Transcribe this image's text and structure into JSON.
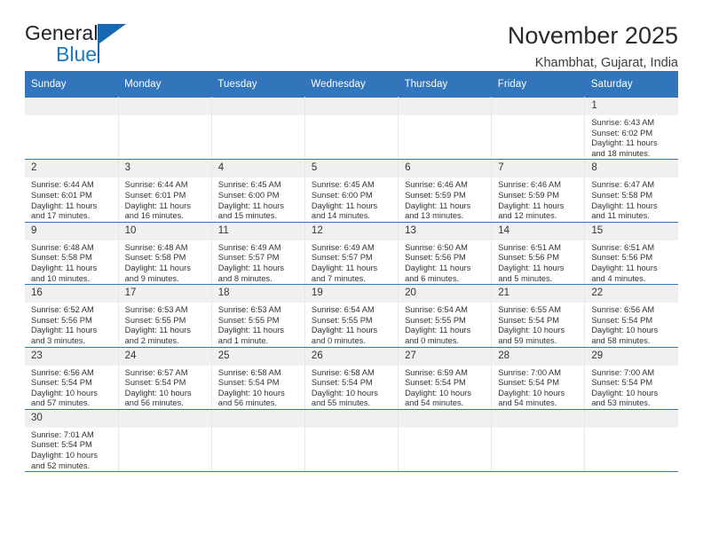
{
  "brand": {
    "name_part1": "General",
    "name_part2": "Blue"
  },
  "header": {
    "title": "November 2025",
    "subtitle": "Khambhat, Gujarat, India"
  },
  "colors": {
    "header_blue": "#3275bb",
    "logo_blue": "#1b7ac2",
    "daynum_band": "#f0f0f0"
  },
  "calendar": {
    "weekday_headers": [
      "Sunday",
      "Monday",
      "Tuesday",
      "Wednesday",
      "Thursday",
      "Friday",
      "Saturday"
    ],
    "weeks": [
      [
        {
          "day": "",
          "lines": []
        },
        {
          "day": "",
          "lines": []
        },
        {
          "day": "",
          "lines": []
        },
        {
          "day": "",
          "lines": []
        },
        {
          "day": "",
          "lines": []
        },
        {
          "day": "",
          "lines": []
        },
        {
          "day": "1",
          "lines": [
            "Sunrise: 6:43 AM",
            "Sunset: 6:02 PM",
            "Daylight: 11 hours",
            "and 18 minutes."
          ]
        }
      ],
      [
        {
          "day": "2",
          "lines": [
            "Sunrise: 6:44 AM",
            "Sunset: 6:01 PM",
            "Daylight: 11 hours",
            "and 17 minutes."
          ]
        },
        {
          "day": "3",
          "lines": [
            "Sunrise: 6:44 AM",
            "Sunset: 6:01 PM",
            "Daylight: 11 hours",
            "and 16 minutes."
          ]
        },
        {
          "day": "4",
          "lines": [
            "Sunrise: 6:45 AM",
            "Sunset: 6:00 PM",
            "Daylight: 11 hours",
            "and 15 minutes."
          ]
        },
        {
          "day": "5",
          "lines": [
            "Sunrise: 6:45 AM",
            "Sunset: 6:00 PM",
            "Daylight: 11 hours",
            "and 14 minutes."
          ]
        },
        {
          "day": "6",
          "lines": [
            "Sunrise: 6:46 AM",
            "Sunset: 5:59 PM",
            "Daylight: 11 hours",
            "and 13 minutes."
          ]
        },
        {
          "day": "7",
          "lines": [
            "Sunrise: 6:46 AM",
            "Sunset: 5:59 PM",
            "Daylight: 11 hours",
            "and 12 minutes."
          ]
        },
        {
          "day": "8",
          "lines": [
            "Sunrise: 6:47 AM",
            "Sunset: 5:58 PM",
            "Daylight: 11 hours",
            "and 11 minutes."
          ]
        }
      ],
      [
        {
          "day": "9",
          "lines": [
            "Sunrise: 6:48 AM",
            "Sunset: 5:58 PM",
            "Daylight: 11 hours",
            "and 10 minutes."
          ]
        },
        {
          "day": "10",
          "lines": [
            "Sunrise: 6:48 AM",
            "Sunset: 5:58 PM",
            "Daylight: 11 hours",
            "and 9 minutes."
          ]
        },
        {
          "day": "11",
          "lines": [
            "Sunrise: 6:49 AM",
            "Sunset: 5:57 PM",
            "Daylight: 11 hours",
            "and 8 minutes."
          ]
        },
        {
          "day": "12",
          "lines": [
            "Sunrise: 6:49 AM",
            "Sunset: 5:57 PM",
            "Daylight: 11 hours",
            "and 7 minutes."
          ]
        },
        {
          "day": "13",
          "lines": [
            "Sunrise: 6:50 AM",
            "Sunset: 5:56 PM",
            "Daylight: 11 hours",
            "and 6 minutes."
          ]
        },
        {
          "day": "14",
          "lines": [
            "Sunrise: 6:51 AM",
            "Sunset: 5:56 PM",
            "Daylight: 11 hours",
            "and 5 minutes."
          ]
        },
        {
          "day": "15",
          "lines": [
            "Sunrise: 6:51 AM",
            "Sunset: 5:56 PM",
            "Daylight: 11 hours",
            "and 4 minutes."
          ]
        }
      ],
      [
        {
          "day": "16",
          "lines": [
            "Sunrise: 6:52 AM",
            "Sunset: 5:56 PM",
            "Daylight: 11 hours",
            "and 3 minutes."
          ]
        },
        {
          "day": "17",
          "lines": [
            "Sunrise: 6:53 AM",
            "Sunset: 5:55 PM",
            "Daylight: 11 hours",
            "and 2 minutes."
          ]
        },
        {
          "day": "18",
          "lines": [
            "Sunrise: 6:53 AM",
            "Sunset: 5:55 PM",
            "Daylight: 11 hours",
            "and 1 minute."
          ]
        },
        {
          "day": "19",
          "lines": [
            "Sunrise: 6:54 AM",
            "Sunset: 5:55 PM",
            "Daylight: 11 hours",
            "and 0 minutes."
          ]
        },
        {
          "day": "20",
          "lines": [
            "Sunrise: 6:54 AM",
            "Sunset: 5:55 PM",
            "Daylight: 11 hours",
            "and 0 minutes."
          ]
        },
        {
          "day": "21",
          "lines": [
            "Sunrise: 6:55 AM",
            "Sunset: 5:54 PM",
            "Daylight: 10 hours",
            "and 59 minutes."
          ]
        },
        {
          "day": "22",
          "lines": [
            "Sunrise: 6:56 AM",
            "Sunset: 5:54 PM",
            "Daylight: 10 hours",
            "and 58 minutes."
          ]
        }
      ],
      [
        {
          "day": "23",
          "lines": [
            "Sunrise: 6:56 AM",
            "Sunset: 5:54 PM",
            "Daylight: 10 hours",
            "and 57 minutes."
          ]
        },
        {
          "day": "24",
          "lines": [
            "Sunrise: 6:57 AM",
            "Sunset: 5:54 PM",
            "Daylight: 10 hours",
            "and 56 minutes."
          ]
        },
        {
          "day": "25",
          "lines": [
            "Sunrise: 6:58 AM",
            "Sunset: 5:54 PM",
            "Daylight: 10 hours",
            "and 56 minutes."
          ]
        },
        {
          "day": "26",
          "lines": [
            "Sunrise: 6:58 AM",
            "Sunset: 5:54 PM",
            "Daylight: 10 hours",
            "and 55 minutes."
          ]
        },
        {
          "day": "27",
          "lines": [
            "Sunrise: 6:59 AM",
            "Sunset: 5:54 PM",
            "Daylight: 10 hours",
            "and 54 minutes."
          ]
        },
        {
          "day": "28",
          "lines": [
            "Sunrise: 7:00 AM",
            "Sunset: 5:54 PM",
            "Daylight: 10 hours",
            "and 54 minutes."
          ]
        },
        {
          "day": "29",
          "lines": [
            "Sunrise: 7:00 AM",
            "Sunset: 5:54 PM",
            "Daylight: 10 hours",
            "and 53 minutes."
          ]
        }
      ],
      [
        {
          "day": "30",
          "lines": [
            "Sunrise: 7:01 AM",
            "Sunset: 5:54 PM",
            "Daylight: 10 hours",
            "and 52 minutes."
          ]
        },
        {
          "day": "",
          "lines": []
        },
        {
          "day": "",
          "lines": []
        },
        {
          "day": "",
          "lines": []
        },
        {
          "day": "",
          "lines": []
        },
        {
          "day": "",
          "lines": []
        },
        {
          "day": "",
          "lines": []
        }
      ]
    ]
  }
}
